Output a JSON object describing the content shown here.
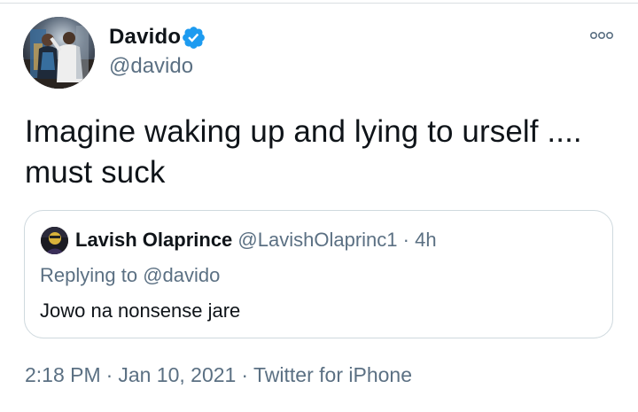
{
  "tweet": {
    "author": {
      "name": "Davido",
      "handle": "@davido",
      "verified": true
    },
    "text_line1": "Imagine waking up and lying to urself ....",
    "text_line2": "must suck",
    "quoted": {
      "author_name": "Lavish Olaprince",
      "author_handle": "@LavishOlaprinc1",
      "dot": "·",
      "age": "4h",
      "replying_prefix": "Replying to ",
      "replying_handle": "@davido",
      "text": "Jowo na nonsense jare"
    },
    "time": "2:18 PM",
    "date": "Jan 10, 2021",
    "separator": "·",
    "source": "Twitter for iPhone"
  },
  "icons": {
    "verified": "verified-badge-icon",
    "more": "more-options-icon"
  },
  "colors": {
    "verified_blue": "#1d9bf0",
    "secondary_text": "#5b7083",
    "border": "#cfd9de",
    "primary_text": "#0f1419"
  }
}
